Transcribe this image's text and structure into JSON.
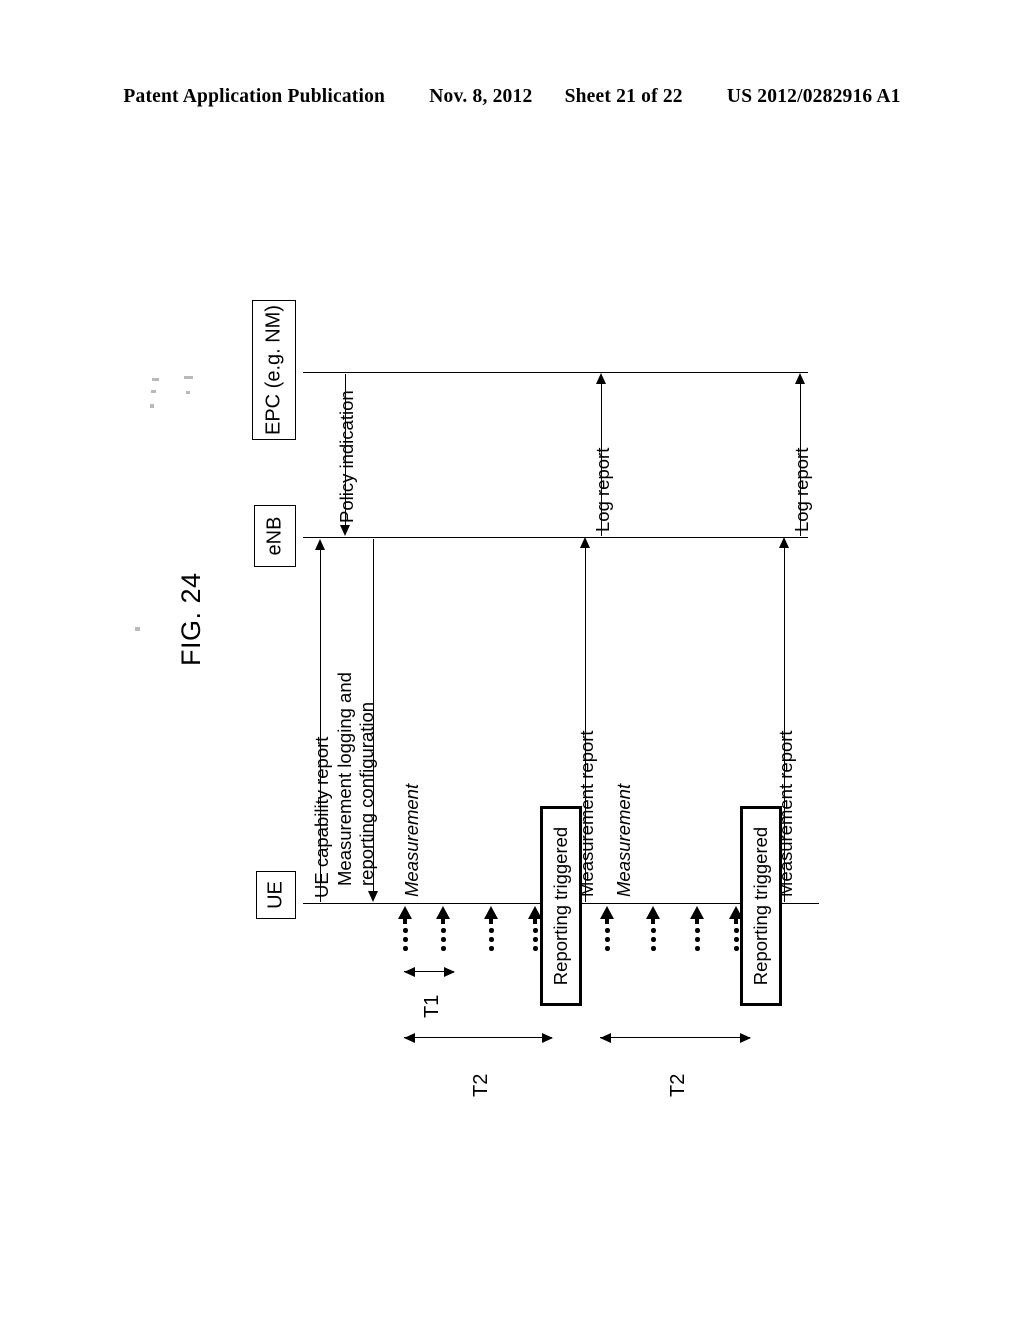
{
  "header": {
    "publication": "Patent Application Publication",
    "date": "Nov. 8, 2012",
    "sheet": "Sheet 21 of 22",
    "patent_number": "US 2012/0282916 A1"
  },
  "figure": {
    "caption": "FIG. 24",
    "type": "sequence-diagram",
    "orientation": "rotated-90-ccw",
    "entities": [
      {
        "id": "epc",
        "label": "EPC (e.g. NM)"
      },
      {
        "id": "enb",
        "label": "eNB"
      },
      {
        "id": "ue",
        "label": "UE"
      }
    ],
    "messages": [
      {
        "id": "m1",
        "label": "Policy indication",
        "from": "epc",
        "to": "enb",
        "direction": "down"
      },
      {
        "id": "m2",
        "label": "UE capability report",
        "from": "ue",
        "to": "enb",
        "direction": "up"
      },
      {
        "id": "m3",
        "label": "Measurement logging and\nreporting configuration",
        "line1": "Measurement logging and",
        "line2": "reporting configuration",
        "from": "enb",
        "to": "ue",
        "direction": "down"
      },
      {
        "id": "m4",
        "label": "Measurement",
        "style": "italic",
        "actor": "ue"
      },
      {
        "id": "m5",
        "label": "Measurement report",
        "from": "ue",
        "to": "enb",
        "direction": "up"
      },
      {
        "id": "m6",
        "label": "Log report",
        "from": "enb",
        "to": "epc",
        "direction": "up"
      },
      {
        "id": "m7",
        "label": "Measurement",
        "style": "italic",
        "actor": "ue"
      },
      {
        "id": "m8",
        "label": "Measurement report",
        "from": "ue",
        "to": "enb",
        "direction": "up"
      },
      {
        "id": "m9",
        "label": "Log report",
        "from": "enb",
        "to": "epc",
        "direction": "up"
      }
    ],
    "activations": [
      {
        "id": "trig1",
        "label": "Reporting triggered",
        "actor": "ue"
      },
      {
        "id": "trig2",
        "label": "Reporting triggered",
        "actor": "ue"
      }
    ],
    "timing_markers": [
      {
        "id": "t1",
        "label": "T1",
        "span": "short"
      },
      {
        "id": "t2a",
        "label": "T2",
        "span": "long"
      },
      {
        "id": "t2b",
        "label": "T2",
        "span": "long"
      }
    ],
    "measurement_ticks": {
      "group1_count": 4,
      "group2_count": 4,
      "symbol": "dotted-up-arrow"
    },
    "colors": {
      "ink": "#000000",
      "paper": "#ffffff"
    }
  }
}
